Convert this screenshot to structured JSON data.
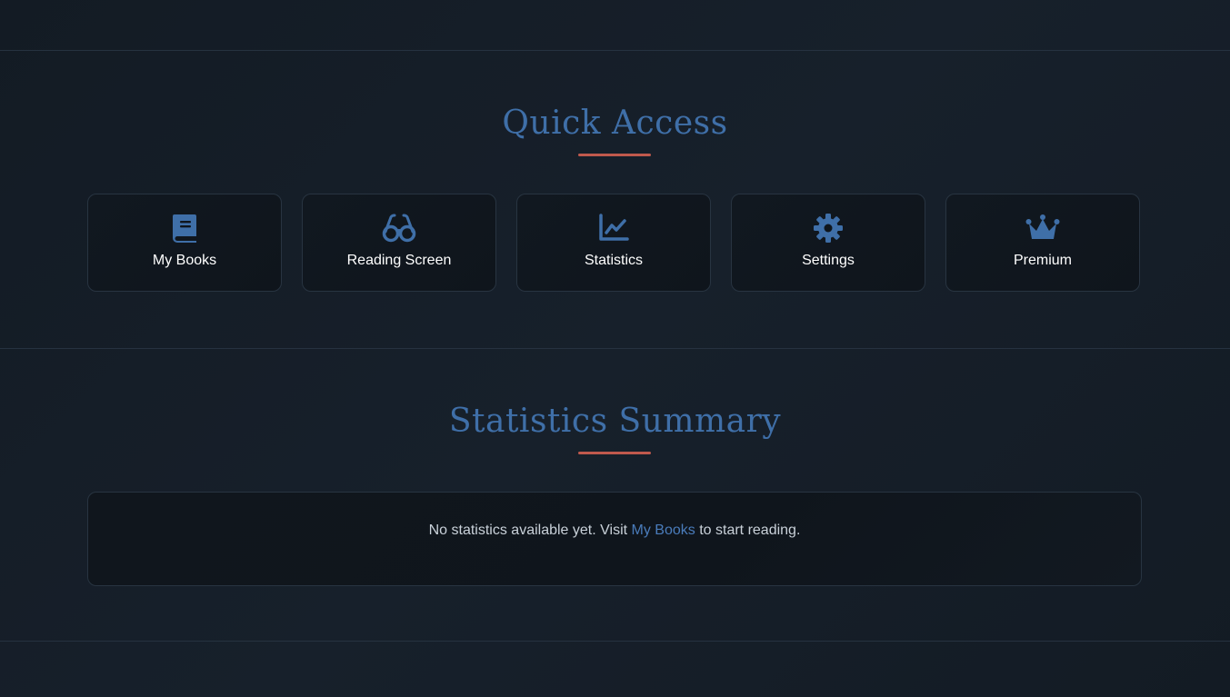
{
  "quick_access": {
    "title": "Quick Access",
    "cards": [
      {
        "label": "My Books",
        "icon": "book-icon"
      },
      {
        "label": "Reading Screen",
        "icon": "glasses-icon"
      },
      {
        "label": "Statistics",
        "icon": "chart-line-icon"
      },
      {
        "label": "Settings",
        "icon": "gear-icon"
      },
      {
        "label": "Premium",
        "icon": "crown-icon"
      }
    ]
  },
  "statistics_summary": {
    "title": "Statistics Summary",
    "message_before": "No statistics available yet. Visit ",
    "link_label": "My Books",
    "message_after": " to start reading."
  },
  "colors": {
    "accent_blue": "#3f6fa8",
    "underline_red": "#c0594d",
    "background": "#151d27"
  }
}
